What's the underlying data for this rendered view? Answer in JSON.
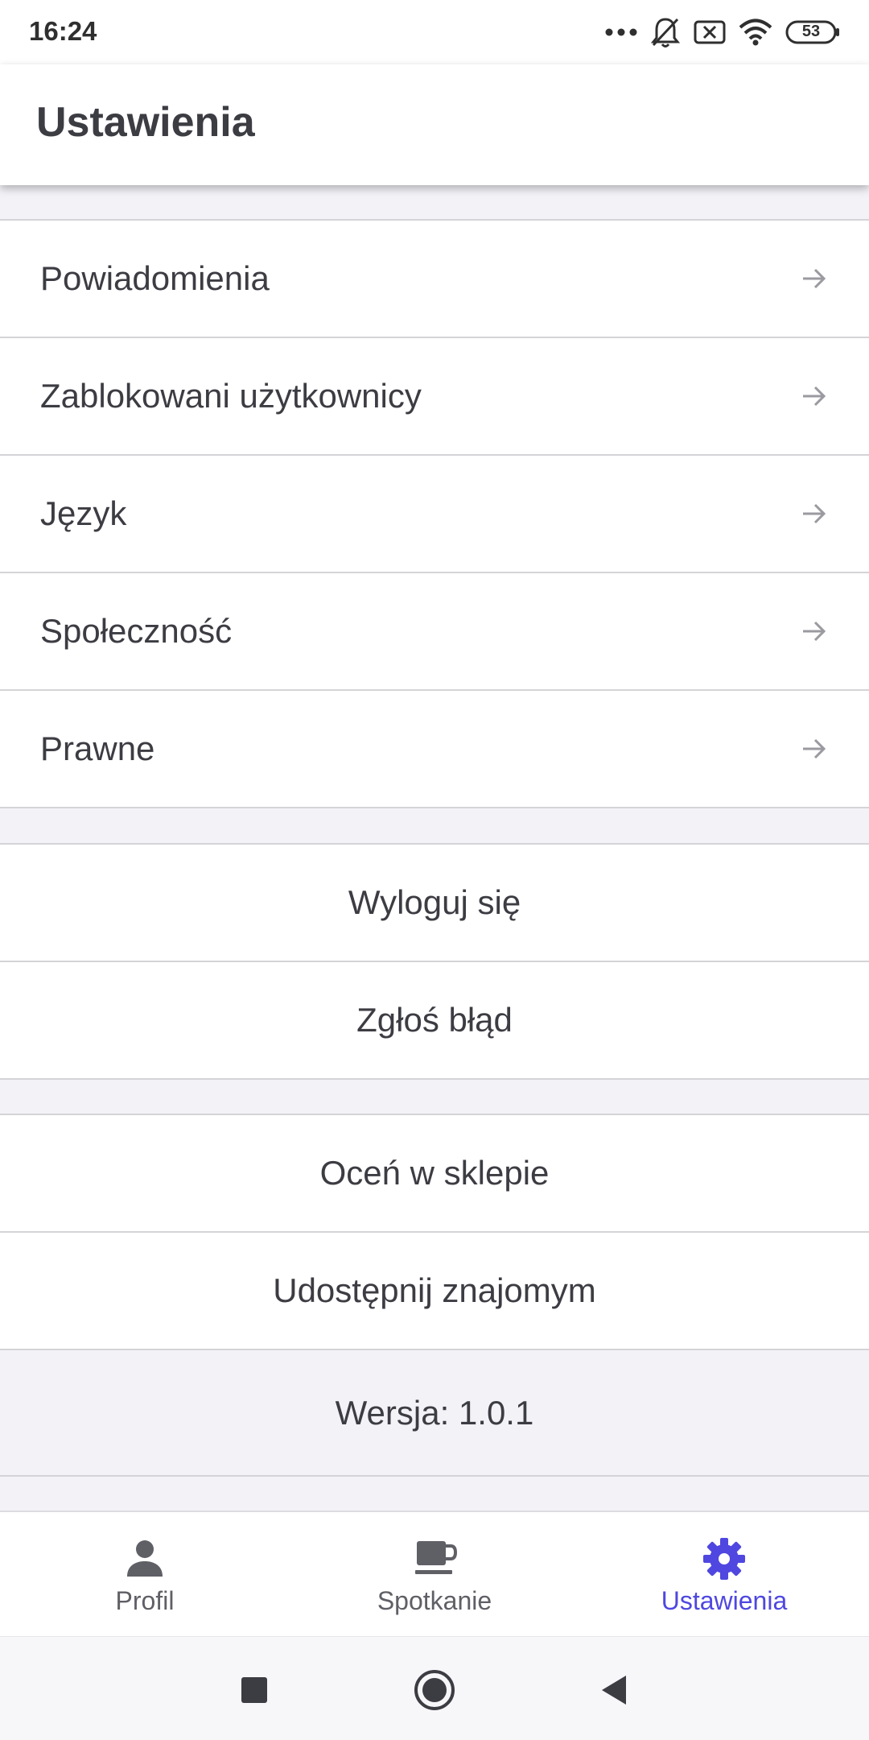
{
  "status_bar": {
    "time": "16:24",
    "battery": "53",
    "icons": [
      "more-dots-icon",
      "bell-muted-icon",
      "sim-off-icon",
      "wifi-icon",
      "battery-icon"
    ]
  },
  "app_bar": {
    "title": "Ustawienia"
  },
  "settings_nav": {
    "items": [
      {
        "label": "Powiadomienia",
        "icon": "arrow-right-icon"
      },
      {
        "label": "Zablokowani użytkownicy",
        "icon": "arrow-right-icon"
      },
      {
        "label": "Język",
        "icon": "arrow-right-icon"
      },
      {
        "label": "Społeczność",
        "icon": "arrow-right-icon"
      },
      {
        "label": "Prawne",
        "icon": "arrow-right-icon"
      }
    ]
  },
  "account_actions": {
    "logout": "Wyloguj się",
    "report_bug": "Zgłoś błąd"
  },
  "share_actions": {
    "rate": "Oceń w sklepie",
    "share": "Udostępnij znajomym"
  },
  "version": "Wersja: 1.0.1",
  "bottom_nav": {
    "active": "Ustawienia",
    "items": [
      {
        "label": "Profil",
        "icon": "person-icon"
      },
      {
        "label": "Spotkanie",
        "icon": "coffee-icon"
      },
      {
        "label": "Ustawienia",
        "icon": "gear-icon"
      }
    ]
  },
  "colors": {
    "accent": "#4f47e0",
    "background": "#f2f2f7",
    "text": "#3c3c43",
    "divider": "#d4d4d8"
  },
  "system_nav": {
    "icons": [
      "recents-square-icon",
      "home-circle-icon",
      "back-triangle-icon"
    ]
  }
}
